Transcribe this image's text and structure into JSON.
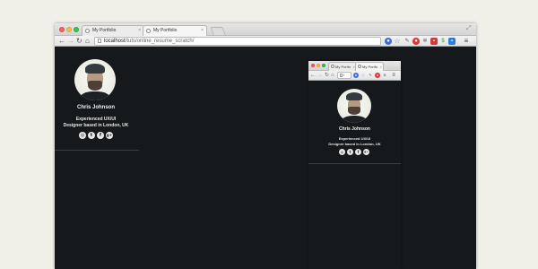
{
  "large_browser": {
    "tabs": [
      {
        "title": "My Portfolio"
      },
      {
        "title": "My Portfolio"
      }
    ],
    "url": {
      "host": "localhost",
      "path": "/tuts/online_resume_scratch/"
    }
  },
  "small_browser": {
    "tabs": [
      {
        "title": "My Portfo"
      },
      {
        "title": "My Portfo"
      }
    ],
    "url": {
      "host": "l",
      "path": ""
    }
  },
  "profile": {
    "name": "Chris Johnson",
    "tagline_line1": "Experienced UX/UI",
    "tagline_line2": "Designer based in London, UK",
    "social": [
      {
        "icon": "dribbble-icon",
        "glyph": "◎"
      },
      {
        "icon": "twitter-icon",
        "glyph": "t"
      },
      {
        "icon": "facebook-icon",
        "glyph": "f"
      },
      {
        "icon": "googleplus-icon",
        "glyph": "g+"
      }
    ]
  },
  "colors": {
    "background": "#f0efe8",
    "page_bg": "#16191c",
    "text": "#f0f0f0"
  }
}
